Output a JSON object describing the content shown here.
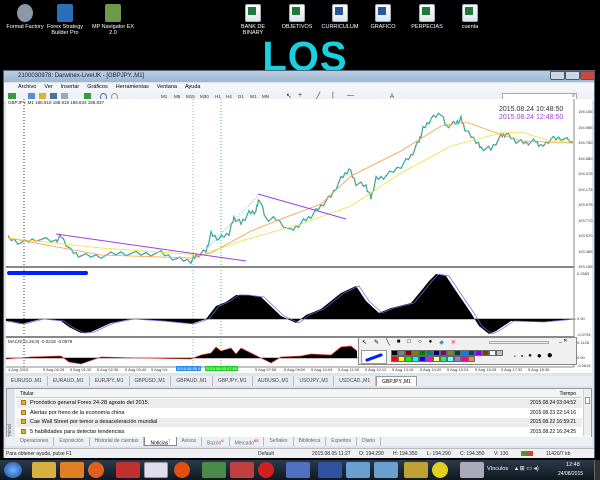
{
  "desktop": {
    "icons_left": [
      "Format Factory",
      "Forex Strategy Builder Pro",
      "MP Navigator EX 2.0"
    ],
    "icons_right": [
      "BANK DE BINARY",
      "OBJETIVOS",
      "CURRICULUM",
      "GRAFICO",
      "PERPECIAS",
      "cuenta"
    ],
    "wallpaper_text": "LOS SUEÑOS"
  },
  "window": {
    "title": "2100030978: Darwinex-LiveUK - [GBPJPY.,M1]",
    "menu": [
      "Archivo",
      "Ver",
      "Insertar",
      "Gráficos",
      "Herramientas",
      "Ventana",
      "Ayuda"
    ],
    "timeframes": [
      "M1",
      "M5",
      "M15",
      "M30",
      "H1",
      "H4",
      "D1",
      "W1",
      "MN"
    ]
  },
  "chart": {
    "header": "GBPJPY.,M1  188.918 188.918 188.834 188.837",
    "time_server": "2015.08.24 10:48:50",
    "time_local": "2015.08.24 12:48:50",
    "price_labels": [
      "195.185",
      "194.985",
      "194.780",
      "194.580",
      "194.375",
      "194.175",
      "193.975",
      "193.770",
      "193.570",
      "193.365",
      "193.165"
    ],
    "osc_labels": [
      "0.2583",
      "0.00",
      "-0.0794"
    ],
    "macd_header": "MACD(12,26,9) -0.0218 -0.0579",
    "macd_labels": [
      "0.1126",
      "0.00",
      "-0.0615"
    ],
    "time_labels": [
      "4 Aug 2015",
      "5 Aug 00:28",
      "5 Aug 01:32",
      "5 Aug 02:36",
      "5 Aug 03:40",
      "5 Aug 04:",
      "5 Aug 07:56",
      "5 Aug 09:00",
      "5 Aug 10:04",
      "5 Aug 11:08",
      "5 Aug 12:12",
      "5 Aug 13:16",
      "5 Aug 14:20",
      "5 Aug 15:24",
      "5 Aug 16:28",
      "5 Aug 17:32",
      "5 Aug 18:36"
    ],
    "time_marker_blue": "2015.08.05 0",
    "time_marker_green": "2015.08.05 07:00",
    "colors": {
      "up": "#20c0b0",
      "down": "#e05050",
      "ma_fast": "#f4a040",
      "ma_slow": "#f0e040",
      "trend": "#a040e0"
    }
  },
  "palette": {
    "colors_top": [
      "#000000",
      "#808080",
      "#800000",
      "#808000",
      "#008000",
      "#008080",
      "#000080",
      "#800080",
      "#808040",
      "#004040",
      "#0080ff",
      "#004080",
      "#8000ff",
      "#804000"
    ],
    "colors_bottom": [
      "#ffffff",
      "#c0c0c0",
      "#ff0000",
      "#ffff00",
      "#00ff00",
      "#00ffff",
      "#0000ff",
      "#ff00ff",
      "#ffff80",
      "#00ff80",
      "#80ffff",
      "#8080ff",
      "#ff0080",
      "#ff8040"
    ]
  },
  "chart_tabs": [
    "EURUSD.,M1",
    "EURAUD.,M1",
    "EURJPY.,M1",
    "GBPUSD.,M1",
    "GBPAUD.,M1",
    "GBPJPY.,M1",
    "AUDUSD.,M1",
    "USDJPY.,M1",
    "USDCAD.,M1",
    "GBPJPY.,M1"
  ],
  "terminal": {
    "side_label": "Terminal",
    "col_title": "Titular",
    "col_time": "Tiempo",
    "rows": [
      {
        "title": "Pronóstico general Forex 24-28 agosto del 2015.",
        "time": "2015.08.24 03:04:52"
      },
      {
        "title": "Alertas por freno de la economía china",
        "time": "2015.08.23 22:14:16"
      },
      {
        "title": "Cae Wall Street por temor a desaceleración mundial",
        "time": "2015.08.22 16:59:21"
      },
      {
        "title": "5 habilidades para detectar tendencias",
        "time": "2015.08.22 16:24:25"
      }
    ],
    "tabs": [
      {
        "label": "Operaciones",
        "badge": ""
      },
      {
        "label": "Exposición",
        "badge": ""
      },
      {
        "label": "Historial de cuentas",
        "badge": ""
      },
      {
        "label": "Noticias",
        "badge": "7"
      },
      {
        "label": "Avisos",
        "badge": ""
      },
      {
        "label": "Buzón",
        "badge": "6"
      },
      {
        "label": "Mercado",
        "badge": "65"
      },
      {
        "label": "Señales",
        "badge": ""
      },
      {
        "label": "Biblioteca",
        "badge": ""
      },
      {
        "label": "Expertos",
        "badge": ""
      },
      {
        "label": "Diario",
        "badge": ""
      }
    ]
  },
  "status": {
    "help": "Para obtener ayuda, pulse F1",
    "profile": "Default",
    "time": "2015.08.05 11:27",
    "open": "O: 194.290",
    "high": "H: 194.350",
    "low": "L: 194.290",
    "close": "C: 194.350",
    "volume": "V: 130",
    "traffic": "11420/7 kb"
  },
  "taskbar": {
    "links": "Vínculos",
    "clock_time": "12:48",
    "clock_date": "24/08/2015"
  }
}
